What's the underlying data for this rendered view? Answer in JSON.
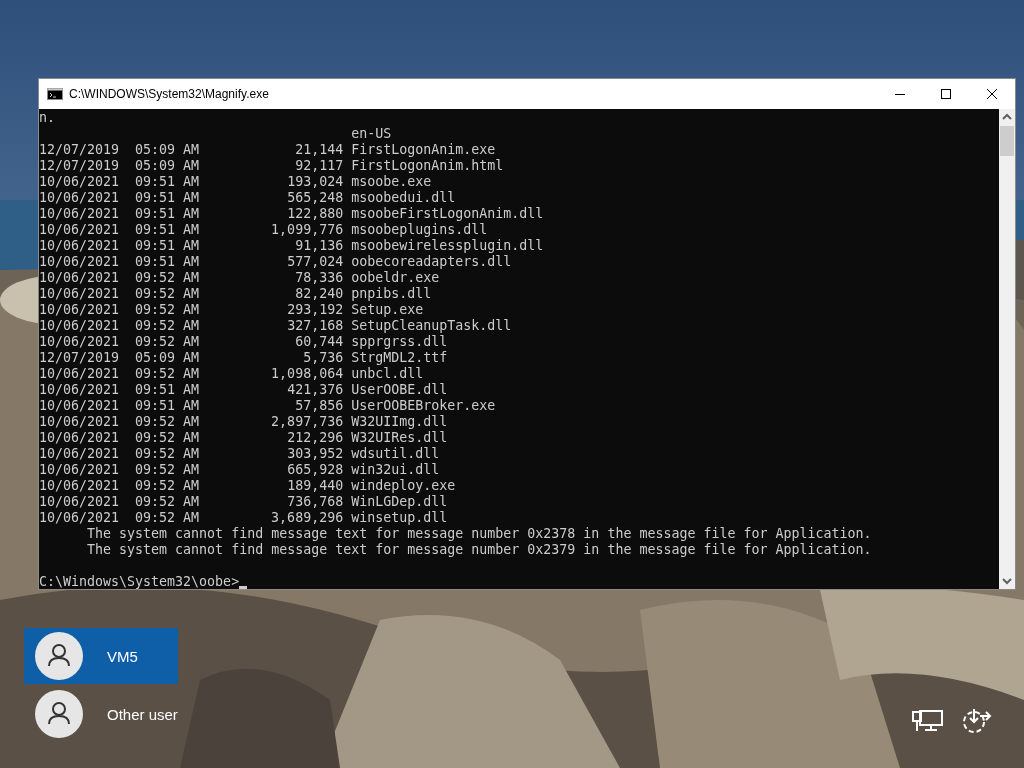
{
  "window": {
    "title": "C:\\WINDOWS\\System32\\Magnify.exe"
  },
  "console": {
    "lines": [
      {
        "kind": "text",
        "text": "n."
      },
      {
        "kind": "dir",
        "name": "en-US"
      },
      {
        "kind": "entry",
        "date": "12/07/2019",
        "time": "05:09 AM",
        "size": "21,144",
        "name": "FirstLogonAnim.exe"
      },
      {
        "kind": "entry",
        "date": "12/07/2019",
        "time": "05:09 AM",
        "size": "92,117",
        "name": "FirstLogonAnim.html"
      },
      {
        "kind": "entry",
        "date": "10/06/2021",
        "time": "09:51 AM",
        "size": "193,024",
        "name": "msoobe.exe"
      },
      {
        "kind": "entry",
        "date": "10/06/2021",
        "time": "09:51 AM",
        "size": "565,248",
        "name": "msoobedui.dll"
      },
      {
        "kind": "entry",
        "date": "10/06/2021",
        "time": "09:51 AM",
        "size": "122,880",
        "name": "msoobeFirstLogonAnim.dll"
      },
      {
        "kind": "entry",
        "date": "10/06/2021",
        "time": "09:51 AM",
        "size": "1,099,776",
        "name": "msoobeplugins.dll"
      },
      {
        "kind": "entry",
        "date": "10/06/2021",
        "time": "09:51 AM",
        "size": "91,136",
        "name": "msoobewirelessplugin.dll"
      },
      {
        "kind": "entry",
        "date": "10/06/2021",
        "time": "09:51 AM",
        "size": "577,024",
        "name": "oobecoreadapters.dll"
      },
      {
        "kind": "entry",
        "date": "10/06/2021",
        "time": "09:52 AM",
        "size": "78,336",
        "name": "oobeldr.exe"
      },
      {
        "kind": "entry",
        "date": "10/06/2021",
        "time": "09:52 AM",
        "size": "82,240",
        "name": "pnpibs.dll"
      },
      {
        "kind": "entry",
        "date": "10/06/2021",
        "time": "09:52 AM",
        "size": "293,192",
        "name": "Setup.exe"
      },
      {
        "kind": "entry",
        "date": "10/06/2021",
        "time": "09:52 AM",
        "size": "327,168",
        "name": "SetupCleanupTask.dll"
      },
      {
        "kind": "entry",
        "date": "10/06/2021",
        "time": "09:52 AM",
        "size": "60,744",
        "name": "spprgrss.dll"
      },
      {
        "kind": "entry",
        "date": "12/07/2019",
        "time": "05:09 AM",
        "size": "5,736",
        "name": "StrgMDL2.ttf"
      },
      {
        "kind": "entry",
        "date": "10/06/2021",
        "time": "09:52 AM",
        "size": "1,098,064",
        "name": "unbcl.dll"
      },
      {
        "kind": "entry",
        "date": "10/06/2021",
        "time": "09:51 AM",
        "size": "421,376",
        "name": "UserOOBE.dll"
      },
      {
        "kind": "entry",
        "date": "10/06/2021",
        "time": "09:51 AM",
        "size": "57,856",
        "name": "UserOOBEBroker.exe"
      },
      {
        "kind": "entry",
        "date": "10/06/2021",
        "time": "09:52 AM",
        "size": "2,897,736",
        "name": "W32UIImg.dll"
      },
      {
        "kind": "entry",
        "date": "10/06/2021",
        "time": "09:52 AM",
        "size": "212,296",
        "name": "W32UIRes.dll"
      },
      {
        "kind": "entry",
        "date": "10/06/2021",
        "time": "09:52 AM",
        "size": "303,952",
        "name": "wdsutil.dll"
      },
      {
        "kind": "entry",
        "date": "10/06/2021",
        "time": "09:52 AM",
        "size": "665,928",
        "name": "win32ui.dll"
      },
      {
        "kind": "entry",
        "date": "10/06/2021",
        "time": "09:52 AM",
        "size": "189,440",
        "name": "windeploy.exe"
      },
      {
        "kind": "entry",
        "date": "10/06/2021",
        "time": "09:52 AM",
        "size": "736,768",
        "name": "WinLGDep.dll"
      },
      {
        "kind": "entry",
        "date": "10/06/2021",
        "time": "09:52 AM",
        "size": "3,689,296",
        "name": "winsetup.dll"
      },
      {
        "kind": "message",
        "text": "The system cannot find message text for message number 0x2378 in the message file for Application."
      },
      {
        "kind": "message",
        "text": "The system cannot find message text for message number 0x2379 in the message file for Application."
      },
      {
        "kind": "blank"
      },
      {
        "kind": "prompt",
        "text": "C:\\Windows\\System32\\oobe>"
      }
    ]
  },
  "users": [
    {
      "name": "VM5",
      "selected": true
    },
    {
      "name": "Other user",
      "selected": false
    }
  ]
}
